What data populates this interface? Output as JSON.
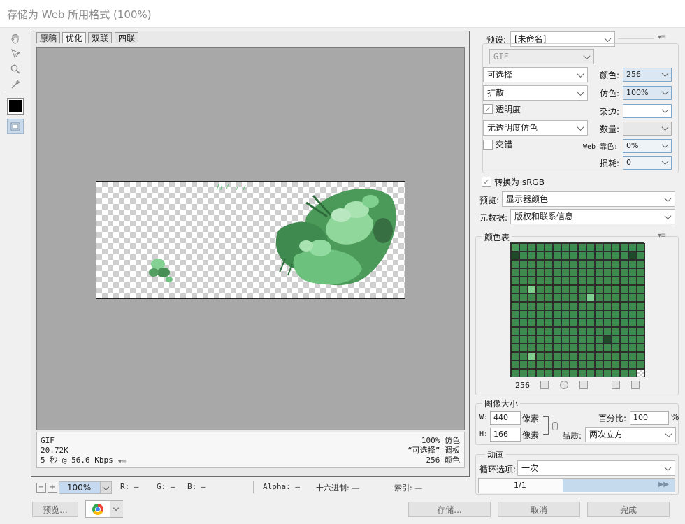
{
  "window": {
    "title": "存储为 Web 所用格式 (100%)"
  },
  "tools": [
    {
      "name": "hand-tool"
    },
    {
      "name": "slice-select-tool"
    },
    {
      "name": "zoom-tool"
    },
    {
      "name": "eyedropper-tool"
    }
  ],
  "tabs": [
    "原稿",
    "优化",
    "双联",
    "四联"
  ],
  "active_tab": "优化",
  "info": {
    "format": "GIF",
    "size": "20.72K",
    "time": "5 秒 @ 56.6 Kbps",
    "dither": "100% 仿色",
    "palette": "“可选择” 调板",
    "colors": "256 颜色"
  },
  "status": {
    "zoom": "100%",
    "r": "R: —",
    "g": "G: —",
    "b": "B: —",
    "alpha": "Alpha: —",
    "hex": "十六进制: —",
    "index": "索引: —"
  },
  "buttons": {
    "preview": "预览...",
    "save": "存储...",
    "cancel": "取消",
    "done": "完成"
  },
  "settings": {
    "preset_label": "预设:",
    "preset_value": "[未命名]",
    "format": "GIF",
    "reduction": "可选择",
    "dither_algo": "扩散",
    "transparency_label": "透明度",
    "matte_algo": "无透明度仿色",
    "interlace_label": "交错",
    "colors_label": "颜色:",
    "colors_value": "256",
    "dither_label": "仿色:",
    "dither_value": "100%",
    "matte_label": "杂边:",
    "amount_label": "数量:",
    "web_snap_label": "Web 靠色:",
    "web_snap_value": "0%",
    "lossy_label": "损耗:",
    "lossy_value": "0",
    "convert_srgb_label": "转换为 sRGB",
    "preview_label": "预览:",
    "preview_value": "显示器颜色",
    "metadata_label": "元数据:",
    "metadata_value": "版权和联系信息"
  },
  "color_table": {
    "title": "颜色表",
    "count": "256",
    "colors": [
      "#3f8a4e",
      "#5fb56f",
      "#2e6b3b",
      "#8fd79b",
      "#4c9a5a",
      "#a8e3b1",
      "#376f43",
      "#6cc27d",
      "#1f4a2a",
      "#7fcf8e",
      "#4a8f58",
      "#b9e8c0",
      "#2b5e35",
      "#5aa86a",
      "#92dba0",
      "#e6f5e8"
    ]
  },
  "image_size": {
    "title": "图像大小",
    "w_label": "W:",
    "w_value": "440",
    "h_label": "H:",
    "h_value": "166",
    "unit": "像素",
    "percent_label": "百分比:",
    "percent_value": "100",
    "percent_unit": "%",
    "quality_label": "品质:",
    "quality_value": "两次立方"
  },
  "animation": {
    "title": "动画",
    "loop_label": "循环选项:",
    "loop_value": "一次",
    "frame": "1/1"
  }
}
